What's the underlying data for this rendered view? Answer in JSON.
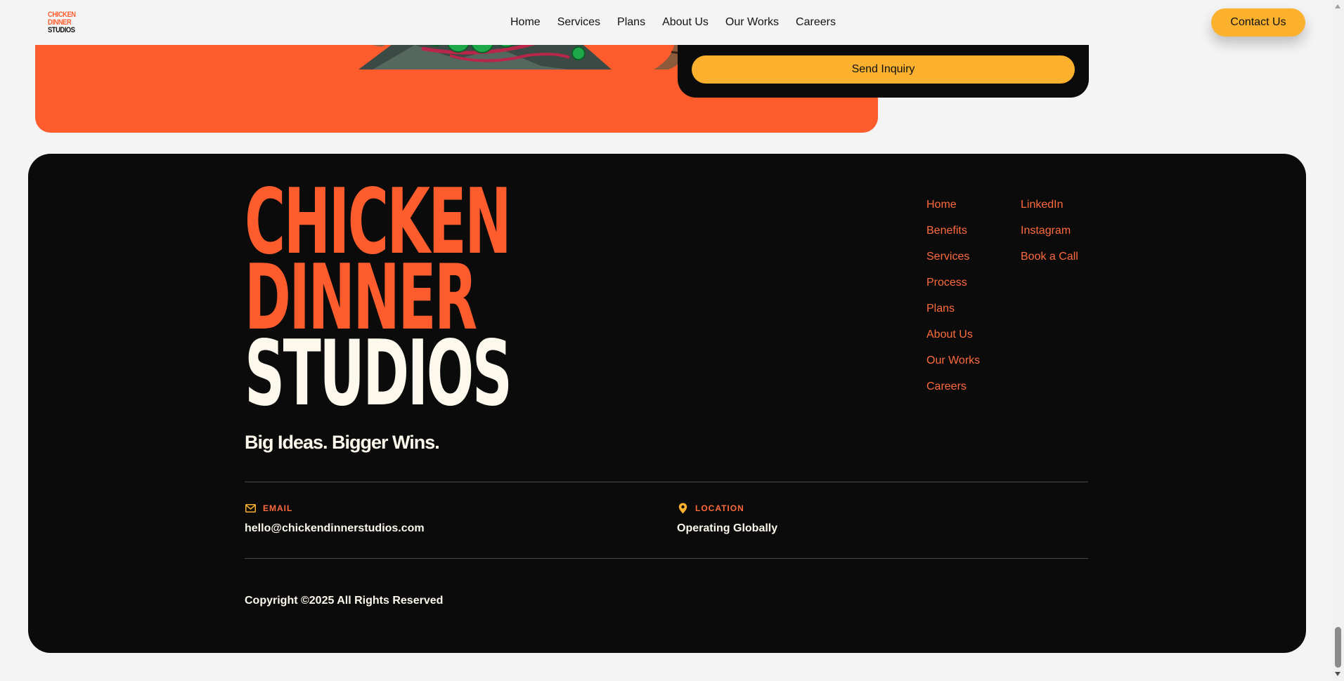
{
  "header": {
    "logo_lines": [
      "CHICKEN",
      "DINNER",
      "STUDIOS"
    ],
    "nav": [
      "Home",
      "Services",
      "Plans",
      "About Us",
      "Our Works",
      "Careers"
    ],
    "contact_label": "Contact Us"
  },
  "inquiry": {
    "button_label": "Send Inquiry"
  },
  "footer": {
    "logo_lines": [
      "CHICKEN",
      "DINNER",
      "STUDIOS"
    ],
    "tagline": "Big Ideas. Bigger Wins.",
    "links_col1": [
      "Home",
      "Benefits",
      "Services",
      "Process",
      "Plans",
      "About Us",
      "Our Works",
      "Careers"
    ],
    "links_col2": [
      "LinkedIn",
      "Instagram",
      "Book a Call"
    ],
    "email_label": "EMAIL",
    "email_value": "hello@chickendinnerstudios.com",
    "location_label": "LOCATION",
    "location_value": "Operating Globally",
    "copyright": "Copyright ©2025 All Rights Reserved"
  },
  "colors": {
    "brand_orange": "#ff5c2e",
    "accent_yellow": "#fbb12e",
    "footer_bg": "#0b0b0b",
    "cream": "#fdf8ec"
  },
  "icons": {
    "email": "envelope-icon",
    "location": "map-pin-icon"
  }
}
